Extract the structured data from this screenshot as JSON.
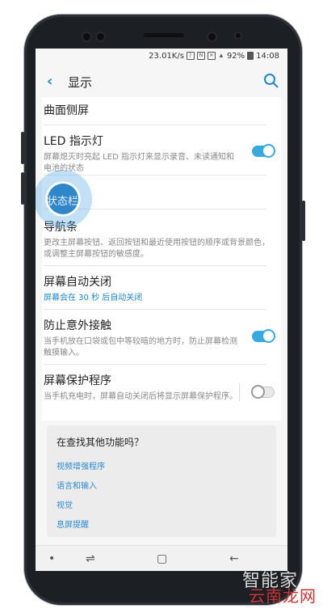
{
  "status_bar": {
    "speed": "23.01K/s",
    "battery": "92%",
    "time": "14:08",
    "icons": [
      "bluetooth-icon",
      "nfc-icon",
      "mute-icon",
      "signal-icon",
      "battery-icon"
    ]
  },
  "app_bar": {
    "title": "显示",
    "icons": {
      "back": "back-arrow-icon",
      "search": "search-icon"
    }
  },
  "settings": {
    "curved_edge": {
      "title": "曲面侧屏"
    },
    "led": {
      "title": "LED 指示灯",
      "subtitle": "屏幕熄灭时亮起 LED 指示灯来显示录音、未读通知和电池的状态",
      "enabled": true
    },
    "status_bar_item": {
      "title": "状态栏"
    },
    "navigation_bar": {
      "title": "导航条",
      "subtitle": "更改主屏幕按钮、返回按钮和最近使用按钮的顺序或背景颜色，或调整主屏幕按钮的敏感度。"
    },
    "screen_timeout": {
      "title": "屏幕自动关闭",
      "subtitle": "屏幕会在 30 秒 后自动关闭"
    },
    "accidental_touch": {
      "title": "防止意外接触",
      "subtitle": "当手机放在口袋或包中等较暗的地方时，防止屏幕检测触摸输入。",
      "enabled": true
    },
    "screensaver": {
      "title": "屏幕保护程序",
      "subtitle": "当手机充电时，屏幕自动关闭后将显示屏幕保护程序。",
      "enabled": false
    }
  },
  "related": {
    "title": "在查找其他功能吗？",
    "links": [
      "视频增强程序",
      "语言和输入",
      "视觉",
      "息屏提醒"
    ]
  },
  "navbar": {
    "icons": [
      "dot-icon",
      "recents-icon",
      "home-icon",
      "back-icon"
    ]
  },
  "watermark": {
    "text": "智能家",
    "site": "云南龙网"
  },
  "colors": {
    "accent": "#1e88c8",
    "toggle_on": "#3aa9e0",
    "touch_indicator": "#2f86c8"
  }
}
